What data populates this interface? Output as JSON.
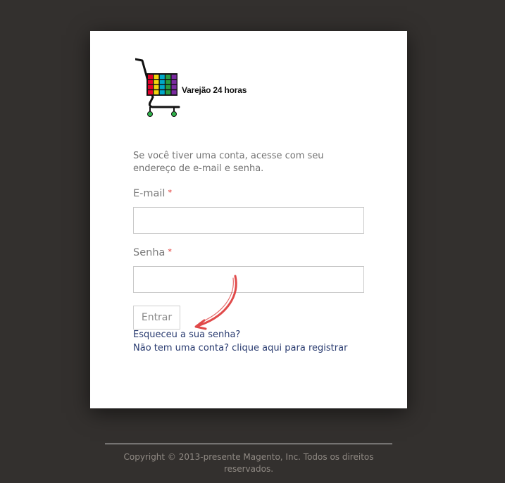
{
  "logo": {
    "text": "Varejão 24 horas",
    "icon": "shopping-cart-icon",
    "colors": [
      "#e4002b",
      "#2a9d3f",
      "#1f4fb4",
      "#f4d40d",
      "#7a2aa0",
      "#f08a00",
      "#00a9c9",
      "#ffffff"
    ]
  },
  "form": {
    "intro": "Se você tiver uma conta, acesse com seu endereço de e-mail e senha.",
    "email_label": "E-mail",
    "password_label": "Senha",
    "required_mark": "*",
    "email_value": "",
    "password_value": "",
    "submit_label": "Entrar"
  },
  "links": {
    "forgot_password": "Esqueceu a sua senha?",
    "register": "Não tem uma conta? clique aqui para registrar"
  },
  "footer": {
    "copyright": "Copyright © 2013-presente Magento, Inc. Todos os direitos reservados."
  },
  "colors": {
    "background": "#33302e",
    "link": "#283a6f",
    "required": "#e02b27",
    "annotation_arrow": "#e04a4a"
  }
}
